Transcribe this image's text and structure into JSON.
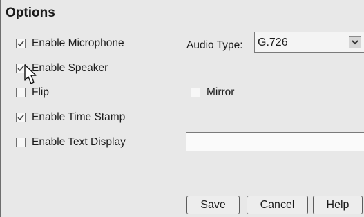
{
  "options": {
    "title": "Options",
    "enable_microphone": {
      "label": "Enable Microphone",
      "checked": true
    },
    "enable_speaker": {
      "label": "Enable Speaker",
      "checked": true
    },
    "flip": {
      "label": "Flip",
      "checked": false
    },
    "mirror": {
      "label": "Mirror",
      "checked": false
    },
    "enable_time_stamp": {
      "label": "Enable Time Stamp",
      "checked": true
    },
    "enable_text_display": {
      "label": "Enable Text Display",
      "checked": false
    },
    "audio_type": {
      "label": "Audio Type:",
      "value": "G.726"
    },
    "text_display_value": ""
  },
  "buttons": {
    "save": "Save",
    "cancel": "Cancel",
    "help": "Help"
  },
  "icons": {
    "checkmark": "checkmark-icon",
    "dropdown": "chevron-down-icon",
    "cursor": "mouse-pointer-icon"
  }
}
